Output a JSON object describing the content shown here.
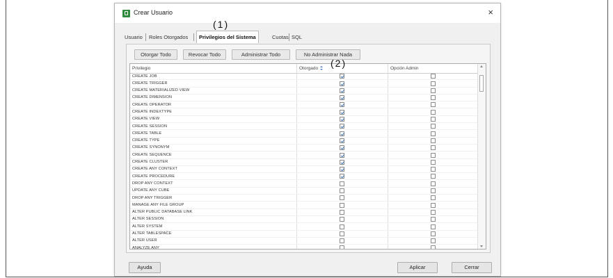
{
  "window": {
    "title": "Crear Usuario",
    "close_glyph": "×"
  },
  "tabs": [
    {
      "label": "Usuario"
    },
    {
      "label": "Roles Otorgados"
    },
    {
      "label": "Privilegios del Sistema",
      "active": true
    },
    {
      "label": "Cuotas"
    },
    {
      "label": "SQL"
    }
  ],
  "annotations": {
    "one": "(1)",
    "two": "(2)"
  },
  "actions": {
    "grant_all": "Otorgar Todo",
    "revoke_all": "Revocar Todo",
    "admin_all": "Administrar Todo",
    "admin_none": "No Administrar Nada"
  },
  "grid": {
    "col_privilege": "Privilegio",
    "col_granted": "Otorgado",
    "col_admin": "Opción Admin",
    "rows": [
      {
        "name": "CREATE JOB",
        "granted": true,
        "admin": false
      },
      {
        "name": "CREATE TRIGGER",
        "granted": true,
        "admin": false
      },
      {
        "name": "CREATE MATERIALIZED VIEW",
        "granted": true,
        "admin": false
      },
      {
        "name": "CREATE DIMENSION",
        "granted": true,
        "admin": false
      },
      {
        "name": "CREATE OPERATOR",
        "granted": true,
        "admin": false
      },
      {
        "name": "CREATE INDEXTYPE",
        "granted": true,
        "admin": false
      },
      {
        "name": "CREATE VIEW",
        "granted": true,
        "admin": false
      },
      {
        "name": "CREATE SESSION",
        "granted": true,
        "admin": false
      },
      {
        "name": "CREATE TABLE",
        "granted": true,
        "admin": false
      },
      {
        "name": "CREATE TYPE",
        "granted": true,
        "admin": false
      },
      {
        "name": "CREATE SYNONYM",
        "granted": true,
        "admin": false
      },
      {
        "name": "CREATE SEQUENCE",
        "granted": true,
        "admin": false
      },
      {
        "name": "CREATE CLUSTER",
        "granted": true,
        "admin": false
      },
      {
        "name": "CREATE ANY CONTEXT",
        "granted": true,
        "admin": false
      },
      {
        "name": "CREATE PROCEDURE",
        "granted": true,
        "admin": false
      },
      {
        "name": "DROP ANY CONTEXT",
        "granted": false,
        "admin": false
      },
      {
        "name": "UPDATE ANY CUBE",
        "granted": false,
        "admin": false
      },
      {
        "name": "DROP ANY TRIGGER",
        "granted": false,
        "admin": false
      },
      {
        "name": "MANAGE ANY FILE GROUP",
        "granted": false,
        "admin": false
      },
      {
        "name": "ALTER PUBLIC DATABASE LINK",
        "granted": false,
        "admin": false
      },
      {
        "name": "ALTER SESSION",
        "granted": false,
        "admin": false
      },
      {
        "name": "ALTER SYSTEM",
        "granted": false,
        "admin": false
      },
      {
        "name": "ALTER TABLESPACE",
        "granted": false,
        "admin": false
      },
      {
        "name": "ALTER USER",
        "granted": false,
        "admin": false
      },
      {
        "name": "ANALYZE ANY",
        "granted": false,
        "admin": false
      }
    ]
  },
  "footer": {
    "help": "Ayuda",
    "apply": "Aplicar",
    "cancel": "Cerrar"
  }
}
